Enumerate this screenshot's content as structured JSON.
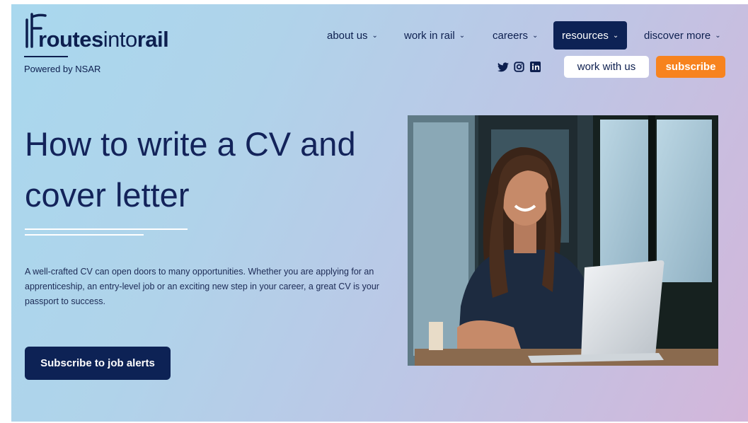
{
  "logo": {
    "text_bold_1": "routes",
    "text_light": "into",
    "text_bold_2": "rail",
    "tagline": "Powered by NSAR"
  },
  "nav": {
    "items": [
      {
        "label": "about us",
        "active": false
      },
      {
        "label": "work in rail",
        "active": false
      },
      {
        "label": "careers",
        "active": false
      },
      {
        "label": "resources",
        "active": true
      },
      {
        "label": "discover more",
        "active": false
      }
    ],
    "socials": [
      "twitter-icon",
      "instagram-icon",
      "linkedin-icon"
    ],
    "work_with_us": "work with us",
    "subscribe": "subscribe"
  },
  "hero": {
    "title_line1": "How to write a CV and",
    "title_line2": "cover letter",
    "description": "A well-crafted CV can open doors to many opportunities. Whether you are applying for an apprenticeship, an entry-level job or an exciting new step in your career, a great CV is your passport to success.",
    "cta": "Subscribe to job alerts"
  },
  "colors": {
    "navy": "#0d2255",
    "orange": "#f7831e",
    "bg_start": "#a9d8ee",
    "bg_end": "#d3b6da"
  }
}
